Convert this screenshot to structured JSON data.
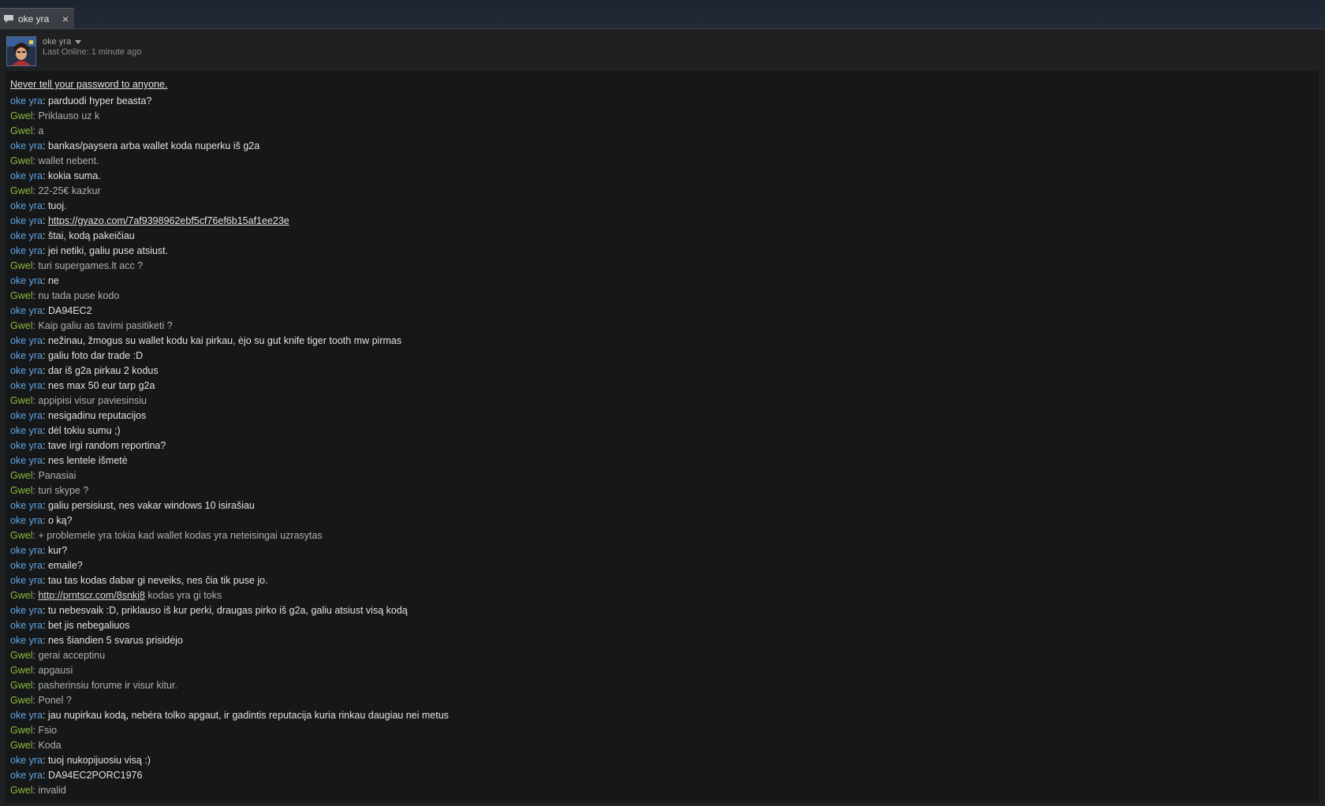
{
  "tab": {
    "title": "oke yra",
    "close": "×"
  },
  "friend": {
    "name": "oke yra",
    "last_online": "Last Online: 1 minute ago"
  },
  "warning": "Never tell your password to anyone.",
  "colors": {
    "self_name": "#62a7e3",
    "friend_name": "#90ba3c",
    "background": "#151719"
  },
  "messages": [
    {
      "sender": "oke yra",
      "parts": [
        {
          "text": "parduodi hyper beasta?"
        }
      ]
    },
    {
      "sender": "Gwel",
      "parts": [
        {
          "text": "Priklauso uz k"
        }
      ]
    },
    {
      "sender": "Gwel",
      "parts": [
        {
          "text": "a"
        }
      ]
    },
    {
      "sender": "oke yra",
      "parts": [
        {
          "text": "bankas/paysera arba wallet koda nuperku iš g2a"
        }
      ]
    },
    {
      "sender": "Gwel",
      "parts": [
        {
          "text": "wallet nebent."
        }
      ]
    },
    {
      "sender": "oke yra",
      "parts": [
        {
          "text": "kokia suma."
        }
      ]
    },
    {
      "sender": "Gwel",
      "parts": [
        {
          "text": "22-25€ kazkur"
        }
      ]
    },
    {
      "sender": "oke yra",
      "parts": [
        {
          "text": "tuoj."
        }
      ]
    },
    {
      "sender": "oke yra",
      "parts": [
        {
          "text": "https://gyazo.com/7af9398962ebf5cf76ef6b15af1ee23e",
          "link": true
        }
      ]
    },
    {
      "sender": "oke yra",
      "parts": [
        {
          "text": "štai, kodą pakeičiau"
        }
      ]
    },
    {
      "sender": "oke yra",
      "parts": [
        {
          "text": "jei netiki, galiu puse atsiust."
        }
      ]
    },
    {
      "sender": "Gwel",
      "parts": [
        {
          "text": "turi supergames.lt acc ?"
        }
      ]
    },
    {
      "sender": "oke yra",
      "parts": [
        {
          "text": "ne"
        }
      ]
    },
    {
      "sender": "Gwel",
      "parts": [
        {
          "text": "nu tada puse kodo"
        }
      ]
    },
    {
      "sender": "oke yra",
      "parts": [
        {
          "text": "DA94EC2"
        }
      ]
    },
    {
      "sender": "Gwel",
      "parts": [
        {
          "text": "Kaip galiu as tavimi pasitiketi ?"
        }
      ]
    },
    {
      "sender": "oke yra",
      "parts": [
        {
          "text": "nežinau, žmogus su wallet kodu kai pirkau, ėjo su gut knife tiger tooth mw pirmas"
        }
      ]
    },
    {
      "sender": "oke yra",
      "parts": [
        {
          "text": "galiu foto dar trade :D"
        }
      ]
    },
    {
      "sender": "oke yra",
      "parts": [
        {
          "text": "dar iš g2a pirkau 2 kodus"
        }
      ]
    },
    {
      "sender": "oke yra",
      "parts": [
        {
          "text": "nes max 50 eur tarp g2a"
        }
      ]
    },
    {
      "sender": "Gwel",
      "parts": [
        {
          "text": "appipisi visur paviesinsiu"
        }
      ]
    },
    {
      "sender": "oke yra",
      "parts": [
        {
          "text": "nesigadinu reputacijos"
        }
      ]
    },
    {
      "sender": "oke yra",
      "parts": [
        {
          "text": "dėl tokiu sumu ;)"
        }
      ]
    },
    {
      "sender": "oke yra",
      "parts": [
        {
          "text": "tave irgi random reportina?"
        }
      ]
    },
    {
      "sender": "oke yra",
      "parts": [
        {
          "text": "nes lentele išmetė"
        }
      ]
    },
    {
      "sender": "Gwel",
      "parts": [
        {
          "text": "Panasiai"
        }
      ]
    },
    {
      "sender": "Gwel",
      "parts": [
        {
          "text": "turi skype ?"
        }
      ]
    },
    {
      "sender": "oke yra",
      "parts": [
        {
          "text": "galiu persisiust, nes vakar windows 10 isirašiau"
        }
      ]
    },
    {
      "sender": "oke yra",
      "parts": [
        {
          "text": "o ką?"
        }
      ]
    },
    {
      "sender": "Gwel",
      "parts": [
        {
          "text": "+ problemele yra tokia kad wallet kodas yra neteisingai uzrasytas"
        }
      ]
    },
    {
      "sender": "oke yra",
      "parts": [
        {
          "text": "kur?"
        }
      ]
    },
    {
      "sender": "oke yra",
      "parts": [
        {
          "text": "emaile?"
        }
      ]
    },
    {
      "sender": "oke yra",
      "parts": [
        {
          "text": "tau tas kodas dabar gi neveiks, nes čia tik puse jo."
        }
      ]
    },
    {
      "sender": "Gwel",
      "parts": [
        {
          "text": "http://prntscr.com/8snki8",
          "link": true
        },
        {
          "text": " kodas yra gi toks"
        }
      ]
    },
    {
      "sender": "oke yra",
      "parts": [
        {
          "text": "tu nebesvaik :D, priklauso iš kur perki, draugas pirko iš g2a, galiu atsiust visą kodą"
        }
      ]
    },
    {
      "sender": "oke yra",
      "parts": [
        {
          "text": "bet jis nebegaliuos"
        }
      ]
    },
    {
      "sender": "oke yra",
      "parts": [
        {
          "text": "nes šiandien 5 svarus prisidėjo"
        }
      ]
    },
    {
      "sender": "Gwel",
      "parts": [
        {
          "text": "gerai acceptinu"
        }
      ]
    },
    {
      "sender": "Gwel",
      "parts": [
        {
          "text": "apgausi"
        }
      ]
    },
    {
      "sender": "Gwel",
      "parts": [
        {
          "text": "pasherinsiu forume ir visur kitur."
        }
      ]
    },
    {
      "sender": "Gwel",
      "parts": [
        {
          "text": "Ponel ?"
        }
      ]
    },
    {
      "sender": "oke yra",
      "parts": [
        {
          "text": "jau nupirkau kodą, nebėra tolko apgaut, ir gadintis reputacija kuria rinkau daugiau nei metus"
        }
      ]
    },
    {
      "sender": "Gwel",
      "parts": [
        {
          "text": "Fsio"
        }
      ]
    },
    {
      "sender": "Gwel",
      "parts": [
        {
          "text": "Koda"
        }
      ]
    },
    {
      "sender": "oke yra",
      "parts": [
        {
          "text": "tuoj nukopijuosiu visą :)"
        }
      ]
    },
    {
      "sender": "oke yra",
      "parts": [
        {
          "text": "DA94EC2PORC1976"
        }
      ]
    },
    {
      "sender": "Gwel",
      "parts": [
        {
          "text": "invalid"
        }
      ]
    }
  ]
}
